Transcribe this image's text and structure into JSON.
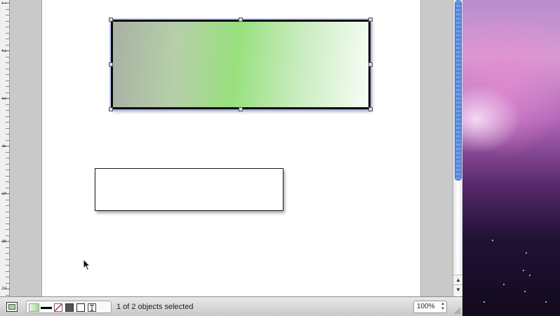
{
  "ruler": {
    "labels": [
      "1",
      "2",
      "3",
      "4",
      "5",
      "6",
      "7"
    ]
  },
  "statusbar": {
    "selection_text": "1 of 2 objects selected",
    "zoom_value": "100%"
  },
  "colors": {
    "selection_handle_outline": "#555555",
    "scroll_thumb": "#6f9de8",
    "gradient_mid": "#98e07e"
  },
  "icons": {
    "fill": "fill-swatch-icon",
    "stroke": "line-style-icon",
    "no_line": "no-line-icon",
    "shadow": "shadow-icon",
    "shape": "shape-icon",
    "text": "text-placement-icon",
    "cursor": "arrow-cursor-icon"
  }
}
